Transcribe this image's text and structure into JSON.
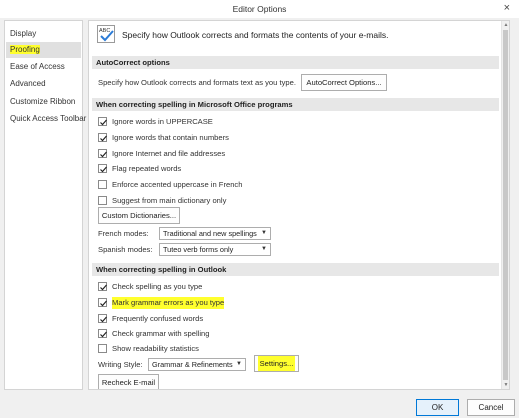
{
  "window": {
    "title": "Editor Options",
    "close_glyph": "×"
  },
  "sidebar": {
    "items": [
      {
        "label": "Display"
      },
      {
        "label": "Proofing"
      },
      {
        "label": "Ease of Access"
      },
      {
        "label": "Advanced"
      },
      {
        "label": "Customize Ribbon"
      },
      {
        "label": "Quick Access Toolbar"
      }
    ]
  },
  "header": {
    "icon_text": "ABC",
    "text": "Specify how Outlook corrects and formats the contents of your e-mails."
  },
  "autocorrect": {
    "section_title": "AutoCorrect options",
    "description": "Specify how Outlook corrects and formats text as you type.",
    "button_label": "AutoCorrect Options..."
  },
  "office": {
    "section_title": "When correcting spelling in Microsoft Office programs",
    "checkboxes": [
      {
        "label": "Ignore words in UPPERCASE",
        "checked": true
      },
      {
        "label": "Ignore words that contain numbers",
        "checked": true
      },
      {
        "label": "Ignore Internet and file addresses",
        "checked": true
      },
      {
        "label": "Flag repeated words",
        "checked": true
      },
      {
        "label": "Enforce accented uppercase in French",
        "checked": false
      },
      {
        "label": "Suggest from main dictionary only",
        "checked": false
      }
    ],
    "custom_dict_label": "Custom Dictionaries...",
    "french_label": "French modes:",
    "french_value": "Traditional and new spellings",
    "spanish_label": "Spanish modes:",
    "spanish_value": "Tuteo verb forms only"
  },
  "outlook": {
    "section_title": "When correcting spelling in Outlook",
    "checkboxes": [
      {
        "label": "Check spelling as you type",
        "checked": true
      },
      {
        "label": "Mark grammar errors as you type",
        "checked": true
      },
      {
        "label": "Frequently confused words",
        "checked": true
      },
      {
        "label": "Check grammar with spelling",
        "checked": true
      },
      {
        "label": "Show readability statistics",
        "checked": false
      }
    ],
    "writing_style_label": "Writing Style:",
    "writing_style_value": "Grammar & Refinements",
    "settings_label": "Settings...",
    "recheck_label": "Recheck E-mail"
  },
  "footer": {
    "ok_label": "OK",
    "cancel_label": "Cancel"
  },
  "colors": {
    "highlight": "#ffff2e",
    "ok_border": "#0078d7",
    "section_bg": "#e7e7e7"
  }
}
